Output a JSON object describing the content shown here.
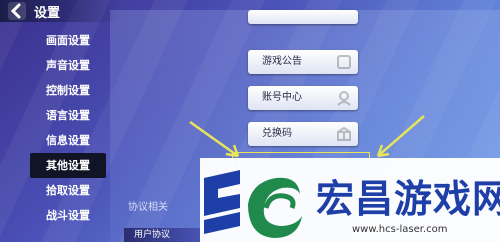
{
  "header": {
    "title": "设置"
  },
  "sidebar": {
    "items": [
      {
        "label": "画面设置"
      },
      {
        "label": "声音设置"
      },
      {
        "label": "控制设置"
      },
      {
        "label": "语言设置"
      },
      {
        "label": "信息设置"
      },
      {
        "label": "其他设置"
      },
      {
        "label": "拾取设置"
      },
      {
        "label": "战斗设置"
      }
    ],
    "active_label": "其他设置"
  },
  "main": {
    "buttons": [
      {
        "label": "游戏公告"
      },
      {
        "label": "账号中心"
      },
      {
        "label": "兑换码"
      }
    ],
    "section_label": "协议相关",
    "user_agreement_label": "用户协议"
  },
  "watermark": {
    "name": "宏昌游戏网",
    "url": "www.hcs-laser.com"
  },
  "colors": {
    "highlight": "#e7e45a",
    "active_item": "#111426",
    "brand": "#1e3fa8"
  }
}
